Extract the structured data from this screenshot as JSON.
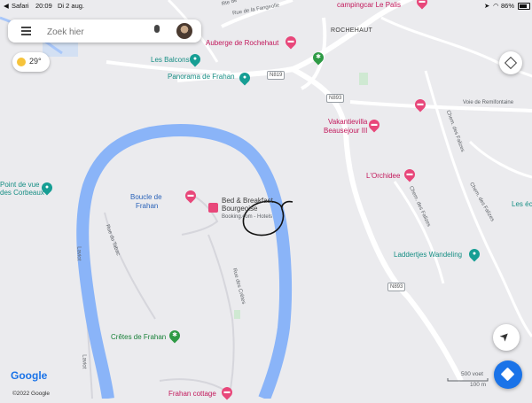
{
  "status_bar": {
    "app": "Safari",
    "time": "20:09",
    "date": "Di 2 aug.",
    "battery": "86%"
  },
  "search": {
    "placeholder": "Zoek hier"
  },
  "weather": {
    "temperature": "29°"
  },
  "places": {
    "campingcar": "campingcar Le Palis",
    "auberge": "Auberge de Rochehaut",
    "rochehaut": "ROCHEHAUT",
    "les_balcons": "Les Balcons",
    "panorama": "Panorama de Frahan",
    "vakantievilla_1": "Vakantievilla",
    "vakantievilla_2": "Beausejour III",
    "orchidee": "L'Orchidee",
    "point_de_vue_1": "Point de vue",
    "point_de_vue_2": "des Corbeaux",
    "boucle_1": "Boucle de",
    "boucle_2": "Frahan",
    "bnb_1": "Bed & Breakfast",
    "bnb_2": "Bourgeoise",
    "bnb_sub": "Booking.com - Hotels",
    "laddertjes": "Laddertjes Wandeling",
    "cretes": "Crêtes de Frahan",
    "frahan_cottage": "Frahan cottage",
    "les_ec": "Les éc"
  },
  "streets": {
    "rue_fangeolle": "Rue de la Fangeolle",
    "rte_de": "Rte de",
    "voie_remifontaine": "Voie de Remifontaine",
    "chem_falizes_1": "Chem. des Falizes",
    "chem_falizes_2": "Chem. des Falizes",
    "chem_falizes_3": "Chem. des Falizes",
    "rue_tabac": "Rue du Tabac",
    "rue_cretes": "Rue des Crêtes",
    "laviot_1": "Laviot",
    "laviot_2": "Laviot"
  },
  "routes": {
    "n819": "N819",
    "n893_a": "N893",
    "n893_b": "N893"
  },
  "attribution": {
    "logo": "Google",
    "copyright": "©2022 Google"
  },
  "scale": {
    "imperial": "500 voet",
    "metric": "100 m"
  },
  "colors": {
    "river": "#8ab4f8",
    "land": "#ebebee",
    "road": "#ffffff",
    "accent_blue": "#1a73e8",
    "annotation": "#111111"
  }
}
